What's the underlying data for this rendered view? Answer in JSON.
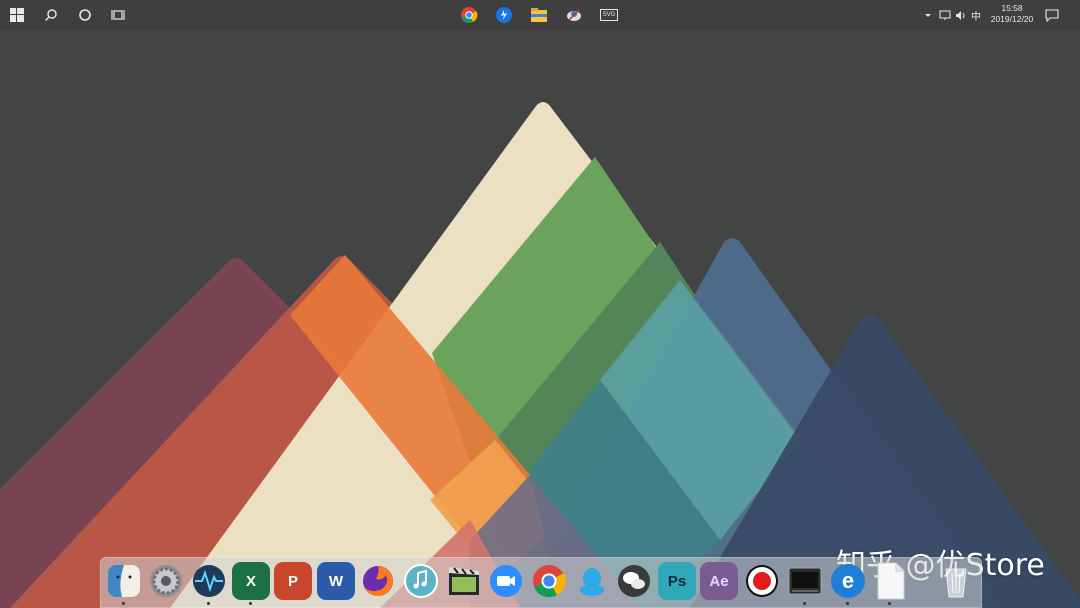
{
  "taskbar": {
    "start_icon": "windows-start-icon",
    "search_icon": "search-icon",
    "cortana_icon": "cortana-circle-icon",
    "taskview_icon": "task-view-icon",
    "pinned": [
      {
        "name": "chrome-icon"
      },
      {
        "name": "teamviewer-icon"
      },
      {
        "name": "file-explorer-icon"
      },
      {
        "name": "satellite-app-icon"
      },
      {
        "name": "svg-viewer-icon",
        "label": "SVG"
      }
    ],
    "tray": {
      "ime": "中",
      "time": "15:58",
      "date": "2019/12/20"
    }
  },
  "dock": {
    "items": [
      {
        "name": "finder-icon",
        "running": true
      },
      {
        "name": "system-settings-icon",
        "running": false
      },
      {
        "name": "activity-monitor-icon",
        "running": true
      },
      {
        "name": "excel-icon",
        "label": "X",
        "running": true
      },
      {
        "name": "powerpoint-icon",
        "label": "P",
        "running": false
      },
      {
        "name": "word-icon",
        "label": "W",
        "running": false
      },
      {
        "name": "firefox-icon",
        "running": false
      },
      {
        "name": "music-icon",
        "running": false
      },
      {
        "name": "video-editor-icon",
        "running": false
      },
      {
        "name": "zoom-icon",
        "running": false
      },
      {
        "name": "chrome-dock-icon",
        "running": false
      },
      {
        "name": "qq-icon",
        "running": false
      },
      {
        "name": "wechat-icon",
        "running": false
      },
      {
        "name": "photoshop-icon",
        "label": "Ps",
        "running": false
      },
      {
        "name": "after-effects-icon",
        "label": "Ae",
        "running": false
      },
      {
        "name": "screen-recorder-icon",
        "running": false
      },
      {
        "name": "terminal-icon",
        "running": true
      },
      {
        "name": "internet-explorer-icon",
        "label": "e",
        "running": true
      },
      {
        "name": "blank-file-icon",
        "running": true
      },
      {
        "name": "trash-icon",
        "running": false
      }
    ]
  },
  "watermark": "知乎 @优Store",
  "colors": {
    "desktop_bg": "#434444",
    "peak_cream": "#ece0c3",
    "peak_green": "#6ba25c",
    "peak_orange": "#e9793a",
    "peak_red": "#c3504e",
    "peak_maroon": "#7c4452",
    "peak_teal": "#4f9aa2",
    "peak_blue": "#4e6f8e",
    "peak_navy": "#394b66"
  }
}
